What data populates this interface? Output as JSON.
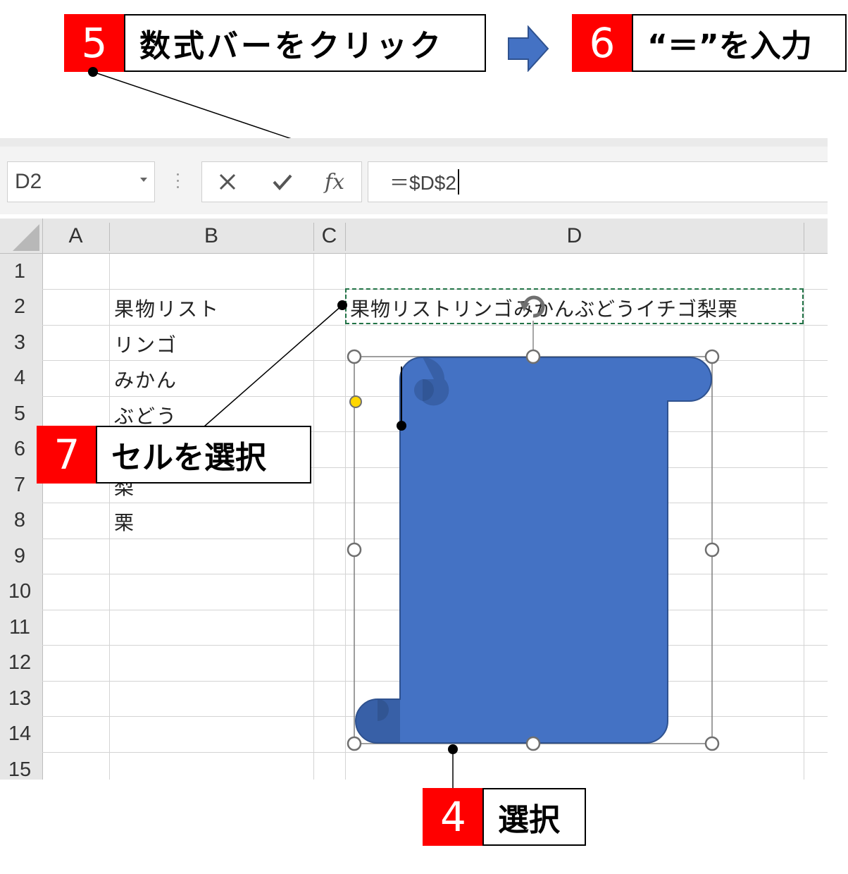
{
  "callouts": {
    "step5": {
      "number": "5",
      "text": "数式バーをクリック"
    },
    "step6": {
      "number": "6",
      "text": "“＝”を入力"
    },
    "step7": {
      "number": "7",
      "text": "セルを選択"
    },
    "step4": {
      "number": "4",
      "text": "選択"
    }
  },
  "colors": {
    "badge": "#ff0000",
    "shape_fill": "#4472c4",
    "shape_edge": "#2f528f",
    "selection_marquee": "#217346",
    "arrow": "#4472c4"
  },
  "formula_bar": {
    "name_box": "D2",
    "cancel_icon": "cancel-icon",
    "enter_icon": "check-icon",
    "fx_label": "fx",
    "formula": "＝$D$2"
  },
  "grid": {
    "columns": [
      "A",
      "B",
      "C",
      "D"
    ],
    "rows": [
      "1",
      "2",
      "3",
      "4",
      "5",
      "6",
      "7",
      "8",
      "9",
      "10",
      "11",
      "12",
      "13",
      "14",
      "15"
    ],
    "cells": {
      "B2": "果物リスト",
      "B3": "リンゴ",
      "B4": "みかん",
      "B5": "ぶどう",
      "B7": "梨",
      "B8": "栗",
      "D2": "果物リストリンゴみかんぶどうイチゴ梨栗"
    }
  },
  "shape": {
    "type": "vertical-scroll",
    "icon": "rotate-handle-icon"
  }
}
